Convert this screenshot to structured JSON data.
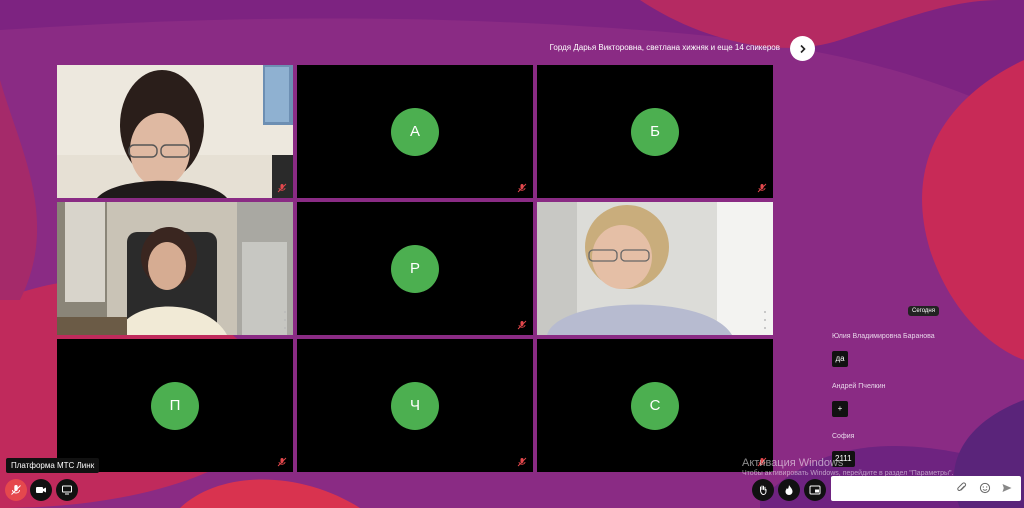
{
  "header": {
    "speakers_text": "Гордя Дарья Викторовна, светлана хижняк и еще 14 спикеров"
  },
  "tiles": [
    {
      "type": "video",
      "scene": "woman-glasses-office"
    },
    {
      "type": "avatar",
      "initial": "А"
    },
    {
      "type": "avatar",
      "initial": "Б"
    },
    {
      "type": "video",
      "scene": "woman-chair-office"
    },
    {
      "type": "avatar",
      "initial": "Р"
    },
    {
      "type": "video",
      "scene": "woman-blonde-window"
    },
    {
      "type": "avatar",
      "initial": "П"
    },
    {
      "type": "avatar",
      "initial": "Ч"
    },
    {
      "type": "avatar",
      "initial": "С"
    }
  ],
  "platform_label": "Платформа МТС Линк",
  "chat": {
    "date_label": "Сегодня",
    "messages": [
      {
        "author": "Юлия Владимировна Баранова",
        "text": "да"
      },
      {
        "author": "Андрей Пчелкин",
        "text": "+"
      },
      {
        "author": "София",
        "text": "2111"
      }
    ]
  },
  "watermark": {
    "line1": "Активация Windows",
    "line2": "Чтобы активировать Windows, перейдите в раздел \"Параметры\"."
  },
  "colors": {
    "avatar_green": "#4caf50",
    "mic_red": "#e5484d",
    "background": "#8c2a7e"
  }
}
